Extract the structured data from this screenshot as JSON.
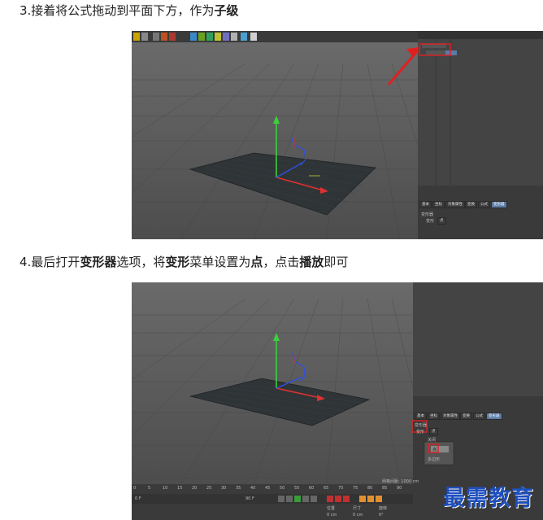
{
  "step3": {
    "prefix": "3.接着将公式拖动到平面下方，作为",
    "bold": "子级"
  },
  "step4": {
    "p1": "4.最后打开",
    "b1": "变形器",
    "p2": "选项，将",
    "b2": "变形",
    "p3": "菜单设置为",
    "b3": "点",
    "p4": "，点击",
    "b4": "播放",
    "p5": "即可"
  },
  "screenshot1": {
    "attr_tabs": [
      "基本",
      "坐标",
      "对象属性",
      "变换",
      "公式",
      "变形器"
    ],
    "selected_tab": "变形器",
    "deformer_heading": "变形器",
    "mode_label": "变形",
    "mode_value": "点"
  },
  "screenshot2": {
    "attr_tabs": [
      "基本",
      "坐标",
      "对象属性",
      "变换",
      "公式",
      "变形器"
    ],
    "selected_tab": "变形器",
    "deformer_heading": "变形器",
    "mode_label": "变形",
    "mode_value": "点",
    "mode_options": [
      "关闭",
      "点",
      "多边形"
    ],
    "timeline_ticks": [
      "0",
      "5",
      "10",
      "15",
      "20",
      "25",
      "30",
      "35",
      "40",
      "45",
      "50",
      "55",
      "60",
      "65",
      "70",
      "75",
      "80",
      "85",
      "90"
    ],
    "frame_start": "0 F",
    "frame_end": "90 F",
    "coord_labels": [
      "位置",
      "尺寸",
      "旋转"
    ],
    "coord_values": [
      "0 cm",
      "0 cm",
      "0°"
    ],
    "viewport_info": "网格间距: 1000 cm"
  },
  "watermark": "最需教育",
  "colors": {
    "viewport_bg": "#5b5b5b",
    "panel_bg": "#3d3d3d",
    "highlight_red": "#e02020",
    "selected_tab": "#5b7aa6",
    "watermark": "#1e4fbf"
  }
}
